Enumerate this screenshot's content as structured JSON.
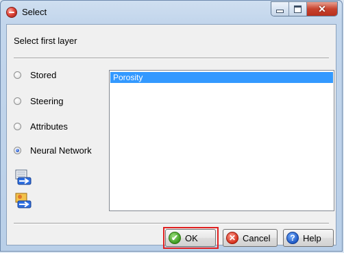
{
  "window": {
    "title": "Select"
  },
  "prompt": "Select first layer",
  "source_options": [
    {
      "label": "Stored",
      "checked": false
    },
    {
      "label": "Steering",
      "checked": false
    },
    {
      "label": "Attributes",
      "checked": false
    },
    {
      "label": "Neural Network",
      "checked": true
    }
  ],
  "layer_list": {
    "items": [
      {
        "label": "Porosity",
        "selected": true
      }
    ]
  },
  "buttons": {
    "ok": "OK",
    "cancel": "Cancel",
    "help": "Help"
  },
  "colors": {
    "selection": "#3399ff",
    "highlight_box": "#e02020",
    "frame": "#b9cfe8"
  }
}
